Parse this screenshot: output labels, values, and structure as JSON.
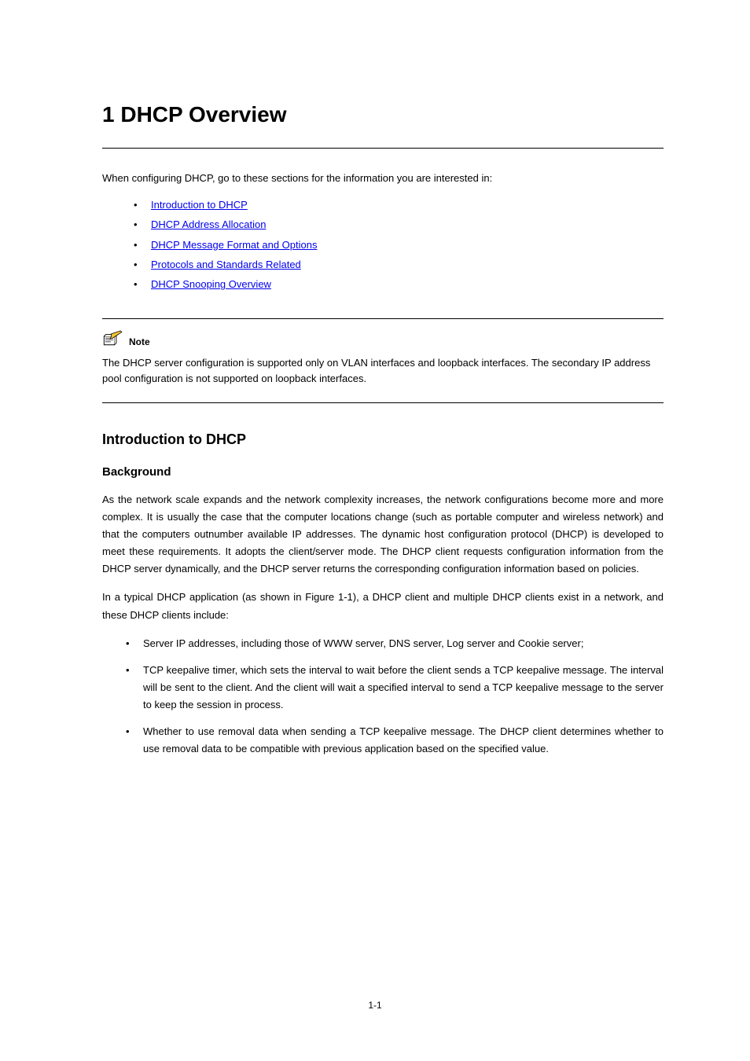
{
  "chapter": {
    "title": "1 DHCP Overview"
  },
  "intro": "When configuring DHCP, go to these sections for the information you are interested in:",
  "toc": [
    {
      "label": "Introduction to DHCP",
      "href": "#"
    },
    {
      "label": "DHCP Address Allocation",
      "href": "#"
    },
    {
      "label": "DHCP Message Format and Options",
      "href": "#"
    },
    {
      "label": "Protocols and Standards Related",
      "href": "#"
    },
    {
      "label": "DHCP Snooping Overview",
      "href": "#"
    }
  ],
  "note": {
    "label": "Note",
    "body": "The DHCP server configuration is supported only on VLAN interfaces and loopback interfaces. The secondary IP address pool configuration is not supported on loopback interfaces."
  },
  "section": {
    "heading": "Introduction to DHCP",
    "subheading": "Background",
    "p1": "As the network scale expands and the network complexity increases, the network configurations become more and more complex. It is usually the case that the computer locations change (such as portable computer and wireless network) and that the computers outnumber available IP addresses. The dynamic host configuration protocol (DHCP) is developed to meet these requirements. It adopts the client/server mode. The DHCP client requests configuration information from the DHCP server dynamically, and the DHCP server returns the corresponding configuration information based on policies.",
    "p2_lead": "In a typical DHCP application (as shown in Figure 1-1), a DHCP client and multiple DHCP clients exist in a network, and these DHCP clients include:",
    "bullets": [
      "Server IP addresses, including those of WWW server, DNS server, Log server and Cookie server;",
      "TCP keepalive timer, which sets the interval to wait before the client sends a TCP keepalive message. The interval will be sent to the client. And the client will wait a specified interval to send a TCP keepalive message to the server to keep the session in process.",
      "Whether to use removal data when sending a TCP keepalive message. The DHCP client determines whether to use removal data to be compatible with previous application based on the specified value."
    ]
  },
  "page_number": "1-1"
}
